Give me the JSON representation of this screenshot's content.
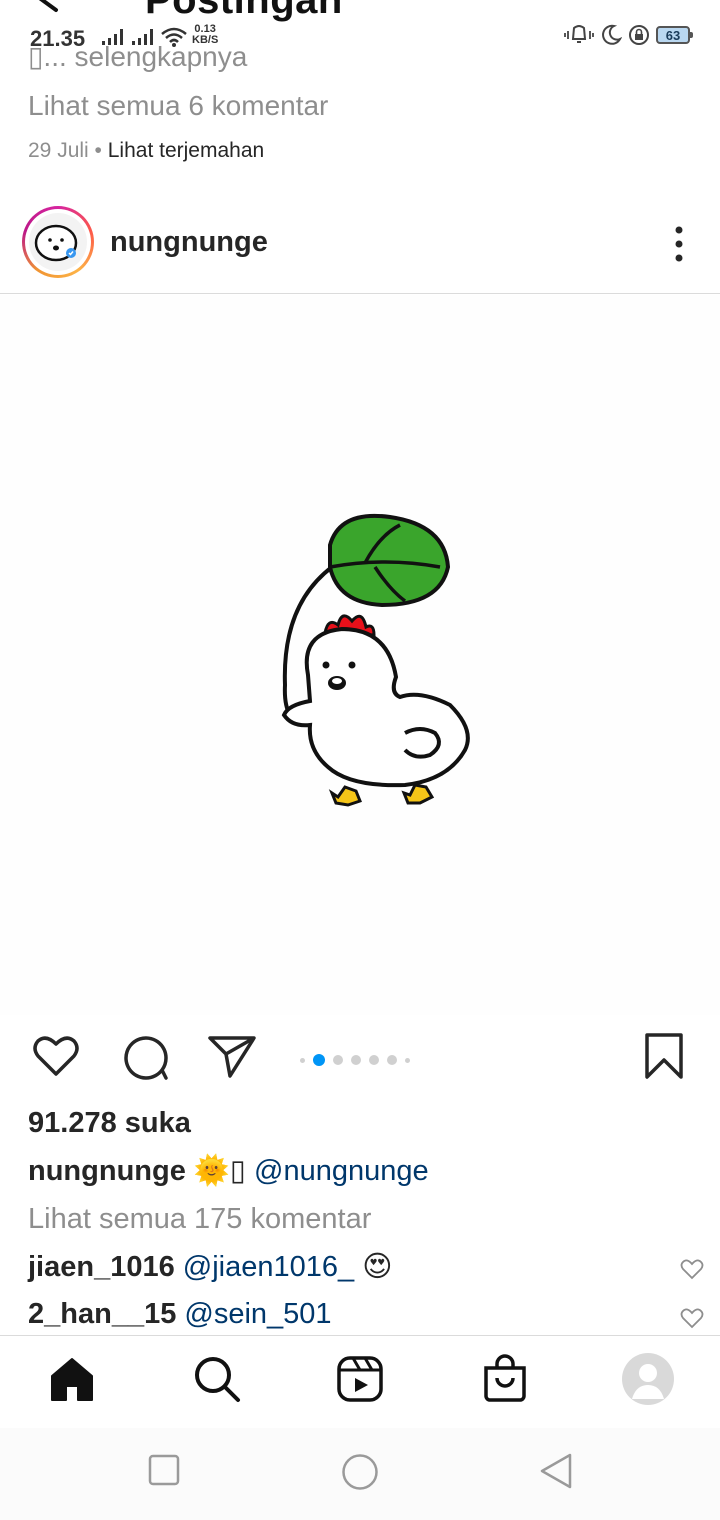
{
  "header": {
    "title": "Postingan"
  },
  "status_bar": {
    "time": "21.35",
    "net_speed_value": "0.13",
    "net_speed_unit": "KB/S",
    "battery": "63"
  },
  "previous_post": {
    "more_text": "▯... selengkapnya",
    "view_comments": "Lihat semua 6 komentar",
    "date": "29 Juli",
    "separator": "•",
    "translate": "Lihat terjemahan"
  },
  "post": {
    "username": "nungnunge",
    "likes": "91.278 suka",
    "caption": {
      "username": "nungnunge",
      "text": " 🌞▯ ",
      "mention": "@nungnunge"
    },
    "view_comments": "Lihat semua 175 komentar",
    "comments": [
      {
        "username": "jiaen_1016",
        "mention": "@jiaen1016_",
        "text": " 😍"
      },
      {
        "username": "2_han__15",
        "mention": "@sein_501",
        "text": ""
      }
    ],
    "carousel": {
      "count": 6,
      "active": 1
    }
  },
  "icons": {
    "like": "heart-icon",
    "comment": "comment-icon",
    "share": "send-icon",
    "save": "bookmark-icon",
    "nav": [
      "home-icon",
      "search-icon",
      "reels-icon",
      "shop-icon",
      "profile-icon"
    ],
    "system": [
      "recents-icon",
      "home-circle-icon",
      "back-triangle-icon"
    ]
  },
  "colors": {
    "accent_blue": "#0095f6",
    "mention": "#00376b",
    "muted": "#8e8e8e",
    "leaf_green": "#3aa52c",
    "comb_red": "#e8101a",
    "feet_yellow": "#f5c518"
  }
}
